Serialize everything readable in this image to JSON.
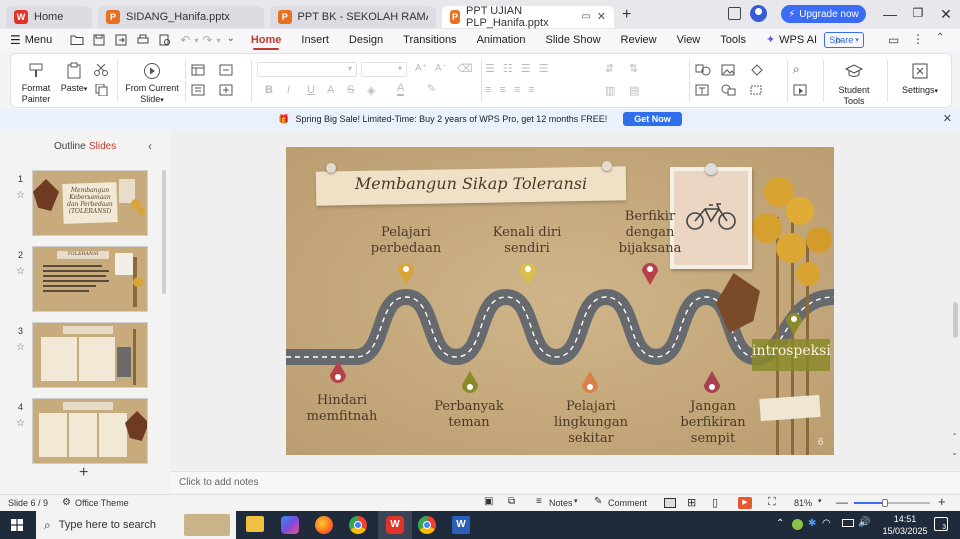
{
  "titlebar": {
    "tabs": [
      {
        "label": "Home",
        "icon": "wps-logo-icon",
        "state": "inactive"
      },
      {
        "label": "SIDANG_Hanifa.pptx",
        "icon": "pptx-icon",
        "state": "inactive"
      },
      {
        "label": "PPT BK - SEKOLAH RAMAH ANAK.ppt",
        "icon": "pptx-icon",
        "state": "inactive"
      },
      {
        "label": "PPT UJIAN PLP_Hanifa.pptx",
        "icon": "pptx-icon",
        "state": "active"
      }
    ],
    "upgrade_label": "Upgrade now"
  },
  "menubar": {
    "menu_label": "Menu",
    "items": [
      "Home",
      "Insert",
      "Design",
      "Transitions",
      "Animation",
      "Slide Show",
      "Review",
      "View",
      "Tools"
    ],
    "active": "Home",
    "wps_ai": "WPS AI",
    "share": "Share"
  },
  "ribbon": {
    "format_painter": "Format Painter",
    "paste": "Paste",
    "from_current_slide": "From Current Slide",
    "student_tools": "Student Tools",
    "settings": "Settings"
  },
  "promo": {
    "text": "Spring Big Sale! Limited-Time: Buy 2 years of WPS Pro, get 12 months FREE!",
    "button": "Get Now"
  },
  "left_pane": {
    "tab_outline": "Outline",
    "tab_slides": "Slides",
    "thumbnails": [
      {
        "num": "1",
        "title": "Membangun Kebersamaan dan Perbedaan (TOLERANSI)"
      },
      {
        "num": "2",
        "title": "TOLERANSI"
      },
      {
        "num": "3",
        "title": ""
      },
      {
        "num": "4",
        "title": ""
      }
    ]
  },
  "slide": {
    "title": "Membangun Sikap Toleransi",
    "steps_top": [
      {
        "label": "Pelajari perbedaan",
        "color": "#d9a33a"
      },
      {
        "label": "Kenali diri sendiri",
        "color": "#d9c04a"
      },
      {
        "label": "Berfikir dengan bijaksana",
        "color": "#b8404a"
      },
      {
        "label": "introspeksi",
        "color": "#8a8a2a"
      }
    ],
    "steps_bottom": [
      {
        "label": "Hindari memfitnah",
        "color": "#b8404a"
      },
      {
        "label": "Perbanyak teman",
        "color": "#8a8a2a"
      },
      {
        "label": "Pelajari lingkungan sekitar",
        "color": "#d9804a"
      },
      {
        "label": "Jangan berfikiran sempit",
        "color": "#a84050"
      }
    ],
    "page_number": "6"
  },
  "notes_placeholder": "Click to add notes",
  "statusbar": {
    "slide_info": "Slide 6 / 9",
    "theme": "Office Theme",
    "notes": "Notes",
    "comment": "Comment",
    "zoom": "81%"
  },
  "taskbar": {
    "search_placeholder": "Type here to search",
    "time": "14:51",
    "date": "15/03/2025",
    "notif_count": "3"
  }
}
